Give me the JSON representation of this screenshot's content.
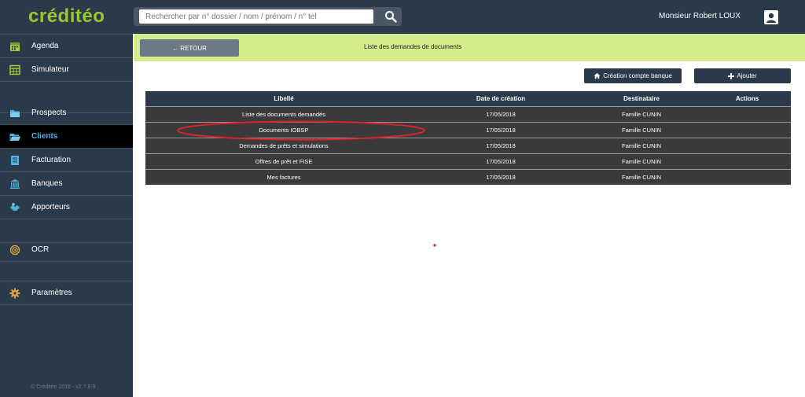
{
  "brand": {
    "logo_text": "créditéo"
  },
  "search": {
    "placeholder": "Rechercher par n° dossier / nom / prénom / n° tel"
  },
  "user": {
    "name": "Monsieur Robert LOUX"
  },
  "sidebar": {
    "items": [
      {
        "label": "Agenda",
        "icon": "calendar-icon"
      },
      {
        "label": "Simulateur",
        "icon": "calculator-icon"
      },
      {
        "label": "Prospects",
        "icon": "folder-icon"
      },
      {
        "label": "Clients",
        "icon": "folder-open-icon",
        "active": true
      },
      {
        "label": "Facturation",
        "icon": "invoice-icon"
      },
      {
        "label": "Banques",
        "icon": "bank-icon"
      },
      {
        "label": "Apporteurs",
        "icon": "handshake-icon"
      },
      {
        "label": "OCR",
        "icon": "ocr-icon"
      },
      {
        "label": "Paramètres",
        "icon": "gear-icon"
      }
    ],
    "copyright": "© Créditéo 2016 - v2.7.6.9"
  },
  "header": {
    "back_label": "← RETOUR",
    "title": "Liste des demandes de documents"
  },
  "actions": {
    "create_bank_label": "Création compte banque",
    "add_label": "Ajouter"
  },
  "table": {
    "columns": [
      "Libellé",
      "Date de création",
      "Destinataire",
      "Actions"
    ],
    "rows": [
      {
        "libelle": "Liste des documents demandés",
        "date": "17/05/2018",
        "destinataire": "Famille CUNIN",
        "actions": ""
      },
      {
        "libelle": "Documents IOBSP",
        "date": "17/05/2018",
        "destinataire": "Famille CUNIN",
        "actions": ""
      },
      {
        "libelle": "Demandes de prêts et simulations",
        "date": "17/05/2018",
        "destinataire": "Famille CUNIN",
        "actions": ""
      },
      {
        "libelle": "Offres de prêt et FISE",
        "date": "17/05/2018",
        "destinataire": "Famille CUNIN",
        "actions": ""
      },
      {
        "libelle": "Mes factures",
        "date": "17/05/2018",
        "destinataire": "Famille CUNIN",
        "actions": ""
      }
    ]
  },
  "colors": {
    "navy": "#2b3a4a",
    "brand_green": "#9bc92d",
    "header_green": "#d5ec8c",
    "active_blue": "#4fb3e0",
    "annotation_red": "#d9242a"
  }
}
